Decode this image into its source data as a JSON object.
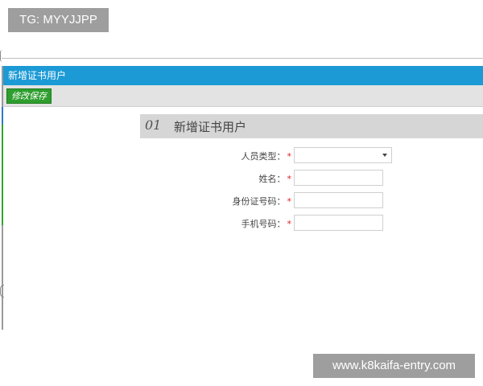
{
  "watermarks": {
    "top_left": "TG: MYYJJPP",
    "bottom_right": "www.k8kaifa-entry.com"
  },
  "window": {
    "title": "新增证书用户"
  },
  "toolbar": {
    "save_label": "修改保存"
  },
  "section": {
    "number": "01",
    "title": "新增证书用户"
  },
  "form": {
    "required_mark": "*",
    "fields": [
      {
        "label": "人员类型：",
        "type": "select",
        "value": ""
      },
      {
        "label": "姓名：",
        "type": "text",
        "value": ""
      },
      {
        "label": "身份证号码：",
        "type": "text",
        "value": ""
      },
      {
        "label": "手机号码：",
        "type": "text",
        "value": ""
      }
    ]
  },
  "colors": {
    "title_bar": "#1b9ad6",
    "save_button": "#2e9e2e",
    "required": "#e02020"
  }
}
